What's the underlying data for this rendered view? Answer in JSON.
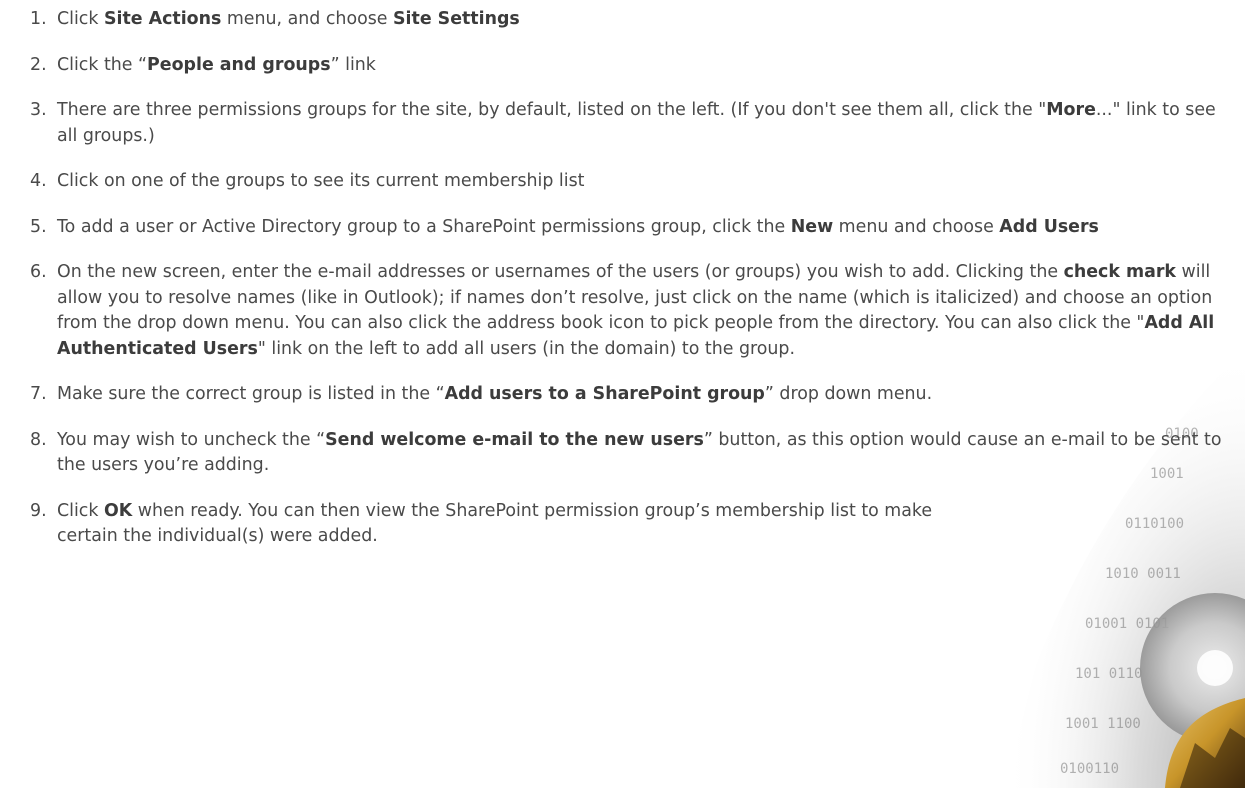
{
  "steps": [
    {
      "num": "1.",
      "parts": [
        {
          "t": "Click "
        },
        {
          "t": "Site Actions",
          "b": true
        },
        {
          "t": " menu, and choose "
        },
        {
          "t": "Site Settings",
          "b": true
        }
      ]
    },
    {
      "num": "2.",
      "parts": [
        {
          "t": "Click the “"
        },
        {
          "t": "People and groups",
          "b": true
        },
        {
          "t": "” link"
        }
      ]
    },
    {
      "num": "3.",
      "parts": [
        {
          "t": "There are three permissions groups for the site, by default, listed on the left.  (If you don't see them all, click the \""
        },
        {
          "t": "More",
          "b": true
        },
        {
          "t": "...\" link to see all groups.)"
        }
      ]
    },
    {
      "num": "4.",
      "parts": [
        {
          "t": "Click on one of the groups to see its current membership list"
        }
      ]
    },
    {
      "num": "5.",
      "parts": [
        {
          "t": "To add a user or Active Directory group to a SharePoint permissions group, click the "
        },
        {
          "t": "New",
          "b": true
        },
        {
          "t": " menu and choose "
        },
        {
          "t": "Add Users",
          "b": true
        }
      ]
    },
    {
      "num": "6.",
      "parts": [
        {
          "t": "On the new screen, enter the e-mail addresses or usernames of the users (or groups) you wish to add.  Clicking the "
        },
        {
          "t": "check mark",
          "b": true
        },
        {
          "t": " will allow you to resolve names (like in Outlook); if names don’t resolve, just click on the name (which is italicized) and choose an option from the drop down menu.  You can also click the address book icon to pick people from the directory.  You can also click the \""
        },
        {
          "t": "Add All Authenticated Users",
          "b": true
        },
        {
          "t": "\" link on the left to add all users (in the domain) to the group."
        }
      ]
    },
    {
      "num": "7.",
      "parts": [
        {
          "t": "Make sure the correct group is listed in the “"
        },
        {
          "t": "Add users to a SharePoint group",
          "b": true
        },
        {
          "t": "” drop down menu."
        }
      ]
    },
    {
      "num": "8.",
      "parts": [
        {
          "t": "You may wish to uncheck the “"
        },
        {
          "t": "Send welcome e-mail to the new users",
          "b": true
        },
        {
          "t": "” button, as this option would cause an e-mail to be sent to the users you’re adding."
        }
      ]
    },
    {
      "num": "9.",
      "parts": [
        {
          "t": "Click "
        },
        {
          "t": "OK",
          "b": true
        },
        {
          "t": " when ready.  You can then view the SharePoint permission group’s membership list to make certain the individual(s) were added."
        }
      ]
    }
  ]
}
